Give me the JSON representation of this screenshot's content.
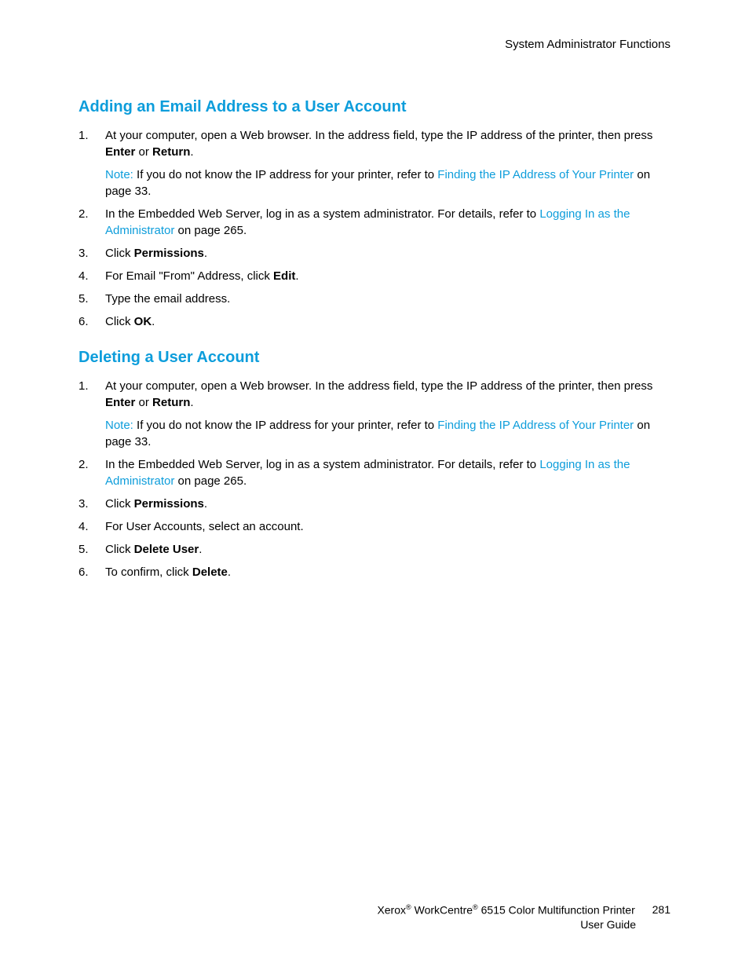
{
  "header": {
    "chapter": "System Administrator Functions"
  },
  "section1": {
    "heading": "Adding an Email Address to a User Account",
    "step1_a": "At your computer, open a Web browser. In the address field, type the IP address of the printer, then press ",
    "step1_b1": "Enter",
    "step1_or": " or ",
    "step1_b2": "Return",
    "step1_end": ".",
    "note_label": "Note:",
    "note_a": " If you do not know the IP address for your printer, refer to ",
    "note_link": "Finding the IP Address of Your Printer",
    "note_end": " on page 33.",
    "step2_a": "In the Embedded Web Server, log in as a system administrator. For details, refer to ",
    "step2_link": "Logging In as the Administrator",
    "step2_end": " on page 265.",
    "step3_a": "Click ",
    "step3_b": "Permissions",
    "step3_end": ".",
    "step4_a": "For Email \"From\" Address, click ",
    "step4_b": "Edit",
    "step4_end": ".",
    "step5": "Type the email address.",
    "step6_a": "Click ",
    "step6_b": "OK",
    "step6_end": "."
  },
  "section2": {
    "heading": "Deleting a User Account",
    "step1_a": "At your computer, open a Web browser. In the address field, type the IP address of the printer, then press ",
    "step1_b1": "Enter",
    "step1_or": " or ",
    "step1_b2": "Return",
    "step1_end": ".",
    "note_label": "Note:",
    "note_a": " If you do not know the IP address for your printer, refer to ",
    "note_link": "Finding the IP Address of Your Printer",
    "note_end": " on page 33.",
    "step2_a": "In the Embedded Web Server, log in as a system administrator. For details, refer to ",
    "step2_link": "Logging In as the Administrator",
    "step2_end": " on page 265.",
    "step3_a": "Click ",
    "step3_b": "Permissions",
    "step3_end": ".",
    "step4": "For User Accounts, select an account.",
    "step5_a": "Click ",
    "step5_b": "Delete User",
    "step5_end": ".",
    "step6_a": "To confirm, click ",
    "step6_b": "Delete",
    "step6_end": "."
  },
  "footer": {
    "line1_a": "Xerox",
    "line1_b": " WorkCentre",
    "line1_c": " 6515 Color Multifunction Printer",
    "page_num": "281",
    "line2": "User Guide"
  }
}
